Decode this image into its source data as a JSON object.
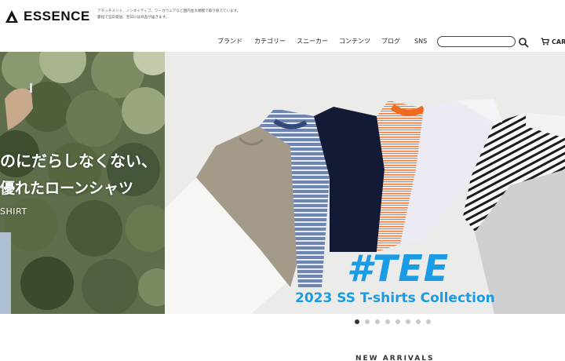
{
  "brand": {
    "name": "ESSENCE",
    "tagline_line1": "アタッチメント、ノンネイティブ、ワーカウェアなど国内並大規模で取り扱えています。",
    "tagline_line2": "最短で当日発送、翌日には商品が届きます。"
  },
  "nav": {
    "items": [
      {
        "label": "ブランド"
      },
      {
        "label": "カテゴリー"
      },
      {
        "label": "スニーカー"
      },
      {
        "label": "コンテンツ"
      },
      {
        "label": "ブログ"
      },
      {
        "label": "SNS"
      }
    ],
    "search_placeholder": "",
    "search_icon": "search-icon",
    "cart_label": "CART",
    "cart_icon": "cart-icon"
  },
  "hero": {
    "prev_slide": {
      "line1": "のにだらしなくない、",
      "line2": "優れたローンシャツ",
      "line3": "SHIRT"
    },
    "current_slide": {
      "title": "#TEE",
      "subtitle": "2023 SS T-shirts Collection",
      "accent_color": "#1a9be6"
    },
    "pagination": {
      "total": 8,
      "active_index": 0
    }
  },
  "section": {
    "new_arrivals": "NEW ARRIVALS"
  }
}
